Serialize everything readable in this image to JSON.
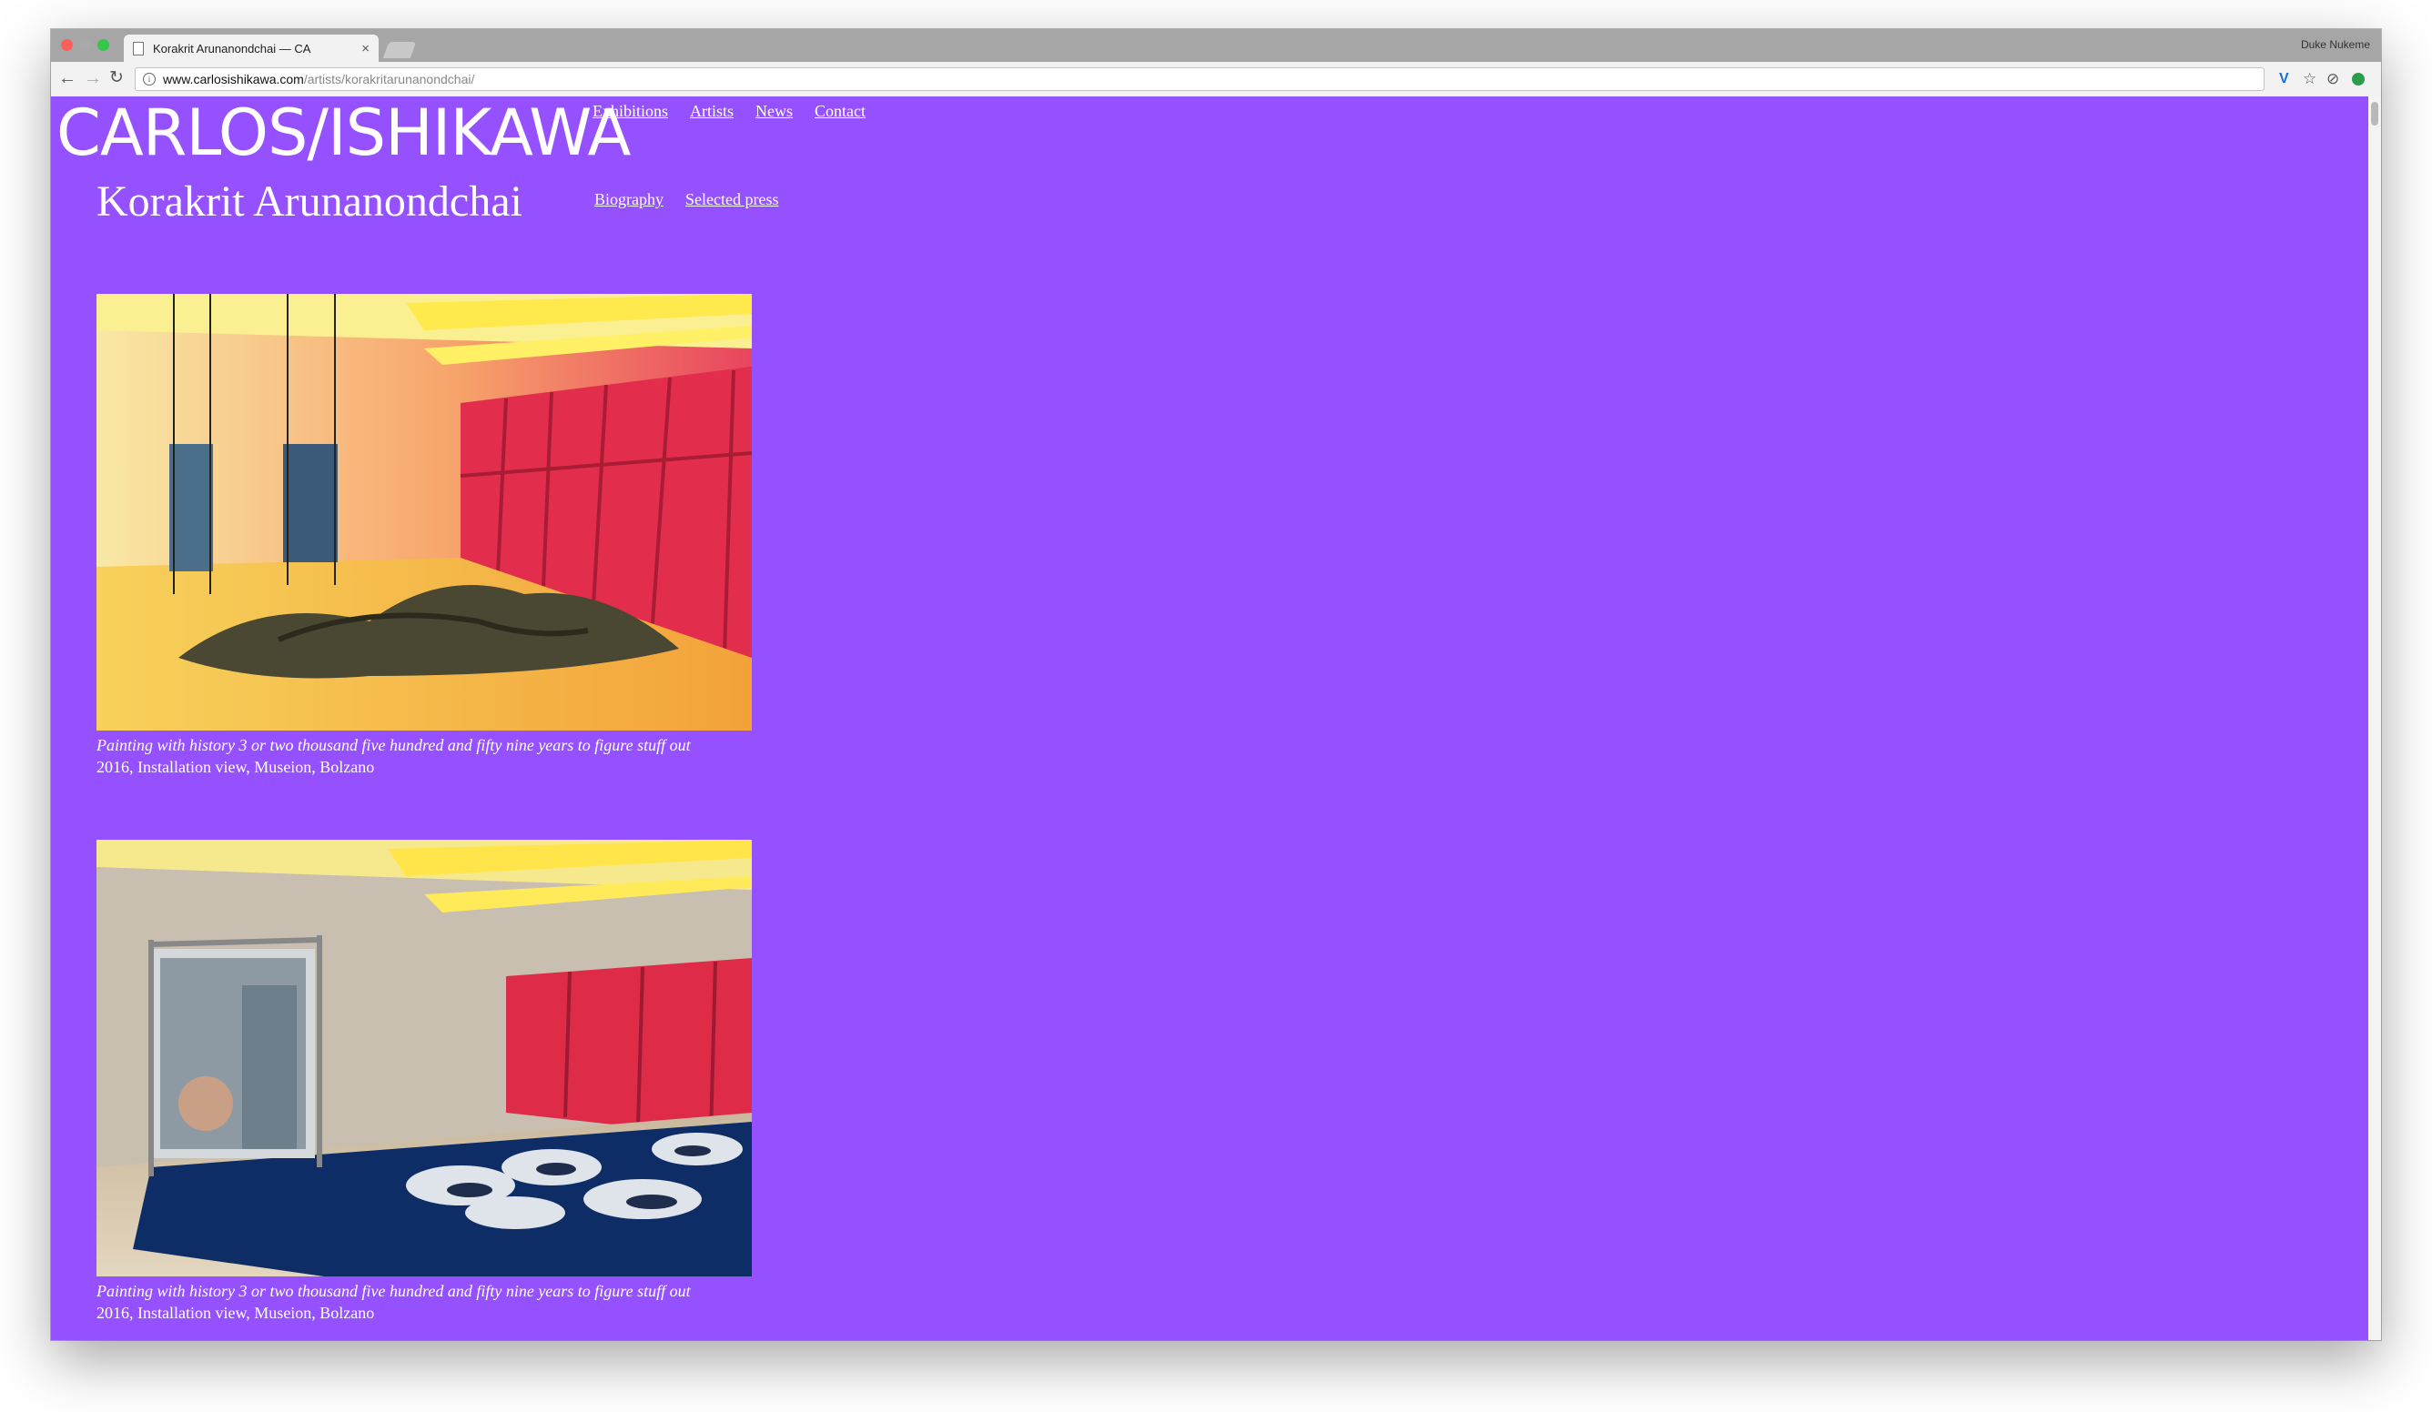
{
  "browser": {
    "tab_title": "Korakrit Arunanondchai — CA",
    "tab_close": "×",
    "profile_name": "Duke Nukeme",
    "url_host": "www.carlosishikawa.com",
    "url_path": "/artists/korakritarunanondchai/"
  },
  "site": {
    "logo": "CARLOS/ISHIKAWA",
    "nav": [
      "Exhibitions",
      "Artists",
      "News",
      "Contact"
    ]
  },
  "artist": {
    "name": "Korakrit Arunanondchai",
    "subnav": [
      "Biography",
      "Selected press"
    ]
  },
  "works": [
    {
      "title": "Painting with history 3 or two thousand five hundred and fifty nine years to figure stuff out",
      "details": "2016, Installation view, Museion, Bolzano"
    },
    {
      "title": "Painting with history 3 or two thousand five hundred and fifty nine years to figure stuff out",
      "details": "2016, Installation view, Museion, Bolzano"
    }
  ],
  "colors": {
    "page_background": "#9551ff"
  }
}
